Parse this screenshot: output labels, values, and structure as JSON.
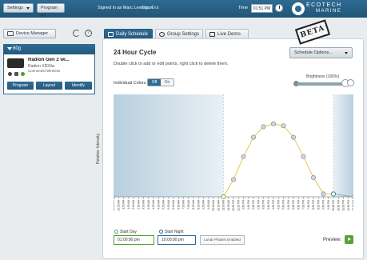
{
  "topbar": {
    "settings_label": "Settings",
    "program_all_label": "Program All",
    "signed_in_text": "Signed in as Marc Levenson",
    "sign_out_label": "Sign Out",
    "time_label": "Time",
    "time_value": "01:51 PM",
    "logo_line1": "ECOTECH",
    "logo_line2": "MARINE"
  },
  "sidebar": {
    "device_manager_label": "Device Manager",
    "group": {
      "name": "60g",
      "device": {
        "name": "Radion Gen 2 wi...",
        "model": "Radion XR30w",
        "connection": "Connected Wireless",
        "buttons": [
          "Program",
          "Layout",
          "Identify"
        ]
      }
    }
  },
  "tabs": [
    {
      "label": "Daily Schedule",
      "active": true
    },
    {
      "label": "Group Settings",
      "active": false
    },
    {
      "label": "Live Demo",
      "active": false
    }
  ],
  "beta_stamp": "BETA",
  "main": {
    "title": "24 Hour Cycle",
    "hint": "Double click to add or edit points, right click to delete them.",
    "schedule_options_label": "Schedule Options...",
    "individual_colors_label": "Individual Colors",
    "toggle_on": "Off",
    "toggle_off": "On",
    "brightness_label": "Brightness (100%)",
    "brightness_value": 0.93
  },
  "chart_data": {
    "type": "line",
    "ylabel": "Relative Intensity",
    "x_ticks": [
      "12:00 AM",
      "12:30 AM",
      "1:00 AM",
      "1:30 AM",
      "2:00 AM",
      "2:30 AM",
      "3:00 AM",
      "3:30 AM",
      "4:00 AM",
      "4:30 AM",
      "5:00 AM",
      "5:30 AM",
      "6:00 AM",
      "6:30 AM",
      "7:00 AM",
      "7:30 AM",
      "8:00 AM",
      "8:30 AM",
      "9:00 AM",
      "9:30 AM",
      "10:00 AM",
      "10:30 AM",
      "11:00 AM",
      "11:30 AM",
      "12:00 PM",
      "12:30 PM",
      "1:00 PM",
      "1:30 PM",
      "2:00 PM",
      "2:30 PM",
      "3:00 PM",
      "3:30 PM",
      "4:00 PM",
      "4:30 PM",
      "5:00 PM",
      "5:30 PM",
      "6:00 PM",
      "6:30 PM",
      "7:00 PM",
      "7:30 PM",
      "8:00 PM",
      "8:30 PM",
      "9:00 PM",
      "9:30 PM",
      "10:00 PM",
      "10:30 PM",
      "11:00 PM",
      "11:30 PM",
      "12:00 AM"
    ],
    "xlim": [
      0,
      24
    ],
    "ylim": [
      0,
      100
    ],
    "day_start_hour": 11,
    "night_start_hour": 22,
    "points": [
      {
        "x": 0,
        "y": 0
      },
      {
        "x": 11,
        "y": 0
      },
      {
        "x": 12,
        "y": 18
      },
      {
        "x": 13,
        "y": 42
      },
      {
        "x": 14,
        "y": 62
      },
      {
        "x": 15,
        "y": 73
      },
      {
        "x": 16,
        "y": 76
      },
      {
        "x": 17,
        "y": 74
      },
      {
        "x": 18,
        "y": 62
      },
      {
        "x": 19,
        "y": 42
      },
      {
        "x": 20,
        "y": 20
      },
      {
        "x": 21,
        "y": 3
      },
      {
        "x": 22,
        "y": 3
      },
      {
        "x": 24,
        "y": 0
      }
    ]
  },
  "footer": {
    "start_day_label": "Start Day",
    "start_day_value": "01:00:00 pm",
    "start_night_label": "Start Night",
    "start_night_value": "10:00:00 pm",
    "lunar_label": "Lunar Phases Enabled",
    "preview_label": "Preview:"
  },
  "colors": {
    "brand_blue": "#2f6b93",
    "day_marker": "#4aa02c",
    "night_marker": "#2f6b93",
    "line_day": "#e8c13a",
    "line_night": "#8ea3b2"
  }
}
